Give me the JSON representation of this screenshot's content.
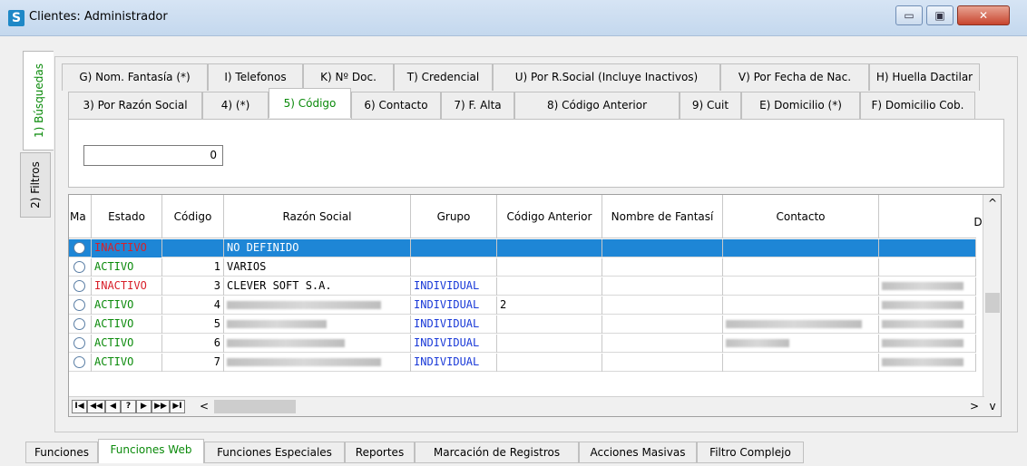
{
  "window": {
    "title": "Clientes: Administrador",
    "min": "▭",
    "max": "▣",
    "close": "✕"
  },
  "side_tabs": [
    "1) Búsquedas",
    "2) Filtros"
  ],
  "search_tabs_row1": [
    "G) Nom. Fantasía (*)",
    "I) Telefonos",
    "K) Nº Doc.",
    "T) Credencial",
    "U) Por R.Social (Incluye Inactivos)",
    "V) Por Fecha de Nac.",
    "H) Huella Dactilar"
  ],
  "search_tabs_row2": [
    "3) Por Razón Social",
    "4) (*)",
    "5) Código",
    "6) Contacto",
    "7) F. Alta",
    "8) Código Anterior",
    "9) Cuit",
    "E) Domicilio (*)",
    "F) Domicilio Cob."
  ],
  "code_value": "0",
  "grid": {
    "columns": [
      "Ma",
      "Estado",
      "Código",
      "Razón Social",
      "Grupo",
      "Código Anterior",
      "Nombre de Fantasí",
      "Contacto",
      "Di"
    ],
    "rows": [
      {
        "estado": "INACTIVO",
        "codigo": "",
        "razon": "NO DEFINIDO",
        "grupo": "",
        "anterior": "",
        "fantasia": "",
        "contacto": ""
      },
      {
        "estado": "ACTIVO",
        "codigo": "1",
        "razon": "VARIOS",
        "grupo": "",
        "anterior": "",
        "fantasia": "",
        "contacto": ""
      },
      {
        "estado": "INACTIVO",
        "codigo": "3",
        "razon": "CLEVER SOFT S.A.",
        "grupo": "INDIVIDUAL",
        "anterior": "",
        "fantasia": "",
        "contacto": ""
      },
      {
        "estado": "ACTIVO",
        "codigo": "4",
        "razon": "",
        "grupo": "INDIVIDUAL",
        "anterior": "2",
        "fantasia": "",
        "contacto": ""
      },
      {
        "estado": "ACTIVO",
        "codigo": "5",
        "razon": "",
        "grupo": "INDIVIDUAL",
        "anterior": "",
        "fantasia": "",
        "contacto": ""
      },
      {
        "estado": "ACTIVO",
        "codigo": "6",
        "razon": "",
        "grupo": "INDIVIDUAL",
        "anterior": "",
        "fantasia": "",
        "contacto": ""
      },
      {
        "estado": "ACTIVO",
        "codigo": "7",
        "razon": "",
        "grupo": "INDIVIDUAL",
        "anterior": "",
        "fantasia": "",
        "contacto": ""
      }
    ]
  },
  "navigator": [
    "I◀",
    "◀◀",
    "◀",
    "?",
    "▶",
    "▶▶",
    "▶I"
  ],
  "hscroll_left": "<",
  "hscroll_right": ">",
  "vscroll_up": "^",
  "vscroll_down": "v",
  "bottom_tabs": [
    "Funciones",
    "Funciones Web",
    "Funciones Especiales",
    "Reportes",
    "Marcación de Registros",
    "Acciones Masivas",
    "Filtro Complejo"
  ],
  "colors": {
    "selected": "#1e86d6",
    "inactive": "#d8202a",
    "active": "#0a8a0a",
    "group": "#1a3ad8"
  }
}
